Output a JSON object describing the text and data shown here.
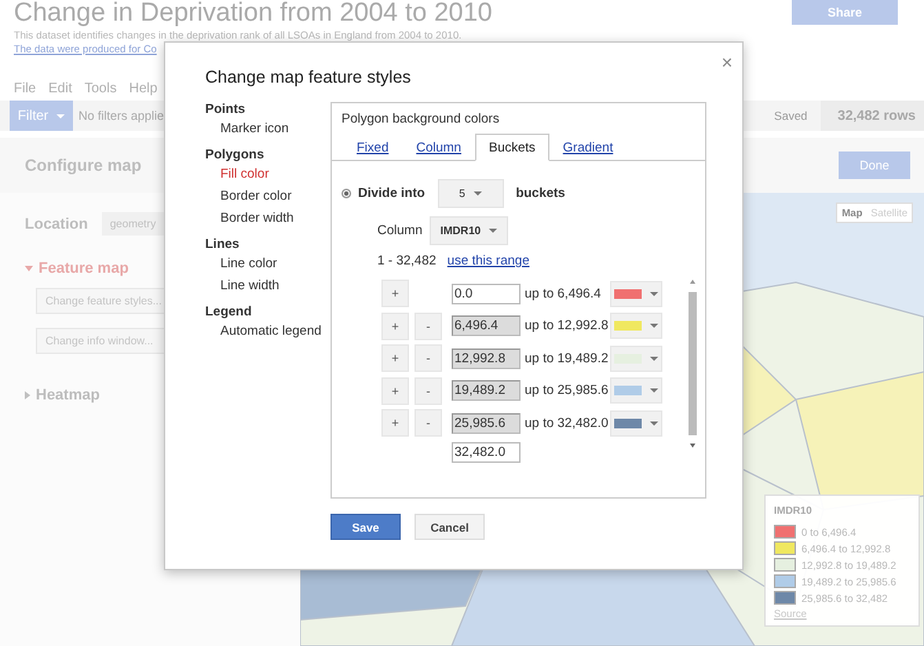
{
  "page": {
    "title": "Change in Deprivation from 2004 to 2010",
    "description": "This dataset identifies changes in the deprivation rank of all LSOAs in England from 2004 to 2010.",
    "link": "The data were produced for Co",
    "share_button": "Share"
  },
  "menu": [
    "File",
    "Edit",
    "Tools",
    "Help"
  ],
  "filter_bar": {
    "button": "Filter",
    "status": "No filters applie",
    "saved": "Saved",
    "row_count": "32,482 rows"
  },
  "config_panel": {
    "title": "Configure map",
    "done_button": "Done",
    "location_label": "Location",
    "location_value": "geometry",
    "sections": [
      {
        "label": "Feature map",
        "expanded": true,
        "buttons": [
          "Change feature styles...",
          "Change info window..."
        ]
      },
      {
        "label": "Heatmap",
        "expanded": false
      }
    ]
  },
  "map": {
    "map_types": [
      {
        "label": "Map",
        "selected": true
      },
      {
        "label": "Satellite",
        "selected": false
      }
    ],
    "legend": {
      "title": "IMDR10",
      "entries": [
        {
          "label": "0 to 6,496.4",
          "color": "#f07070"
        },
        {
          "label": "6,496.4 to 12,992.8",
          "color": "#f0e860"
        },
        {
          "label": "12,992.8 to 19,489.2",
          "color": "#e6f0e0"
        },
        {
          "label": "19,489.2 to 25,985.6",
          "color": "#b0cce8"
        },
        {
          "label": "25,985.6 to 32,482",
          "color": "#6e88a8"
        }
      ],
      "source_link": "Source"
    }
  },
  "dialog": {
    "title": "Change map feature styles",
    "close": "×",
    "nav": [
      {
        "heading": "Points",
        "items": [
          {
            "label": "Marker icon",
            "selected": false
          }
        ]
      },
      {
        "heading": "Polygons",
        "items": [
          {
            "label": "Fill color",
            "selected": true
          },
          {
            "label": "Border color",
            "selected": false
          },
          {
            "label": "Border width",
            "selected": false
          }
        ]
      },
      {
        "heading": "Lines",
        "items": [
          {
            "label": "Line color",
            "selected": false
          },
          {
            "label": "Line width",
            "selected": false
          }
        ]
      },
      {
        "heading": "Legend",
        "items": [
          {
            "label": "Automatic legend",
            "selected": false
          }
        ]
      }
    ],
    "panel": {
      "title": "Polygon background colors",
      "tabs": [
        {
          "label": "Fixed",
          "selected": false
        },
        {
          "label": "Column",
          "selected": false
        },
        {
          "label": "Buckets",
          "selected": true
        },
        {
          "label": "Gradient",
          "selected": false
        }
      ],
      "divide": {
        "selected": true,
        "label": "Divide into",
        "count": "5",
        "suffix": "buckets"
      },
      "column": {
        "label": "Column",
        "value": "IMDR10"
      },
      "range": {
        "text": "1 - 32,482",
        "link": "use this range"
      },
      "add_label": "+",
      "remove_label": "-",
      "buckets": [
        {
          "from": "0.0",
          "to": "up to 6,496.4",
          "color": "#f07070",
          "removable": false,
          "editable": true
        },
        {
          "from": "6,496.4",
          "to": "up to 12,992.8",
          "color": "#f0e860",
          "removable": true,
          "editable": false
        },
        {
          "from": "12,992.8",
          "to": "up to 19,489.2",
          "color": "#e6f0e0",
          "removable": true,
          "editable": false
        },
        {
          "from": "19,489.2",
          "to": "up to 25,985.6",
          "color": "#b0cce8",
          "removable": true,
          "editable": false
        },
        {
          "from": "25,985.6",
          "to": "up to 32,482.0",
          "color": "#6e88a8",
          "removable": true,
          "editable": false
        }
      ],
      "last_value": "32,482.0"
    },
    "buttons": {
      "save": "Save",
      "cancel": "Cancel"
    }
  }
}
